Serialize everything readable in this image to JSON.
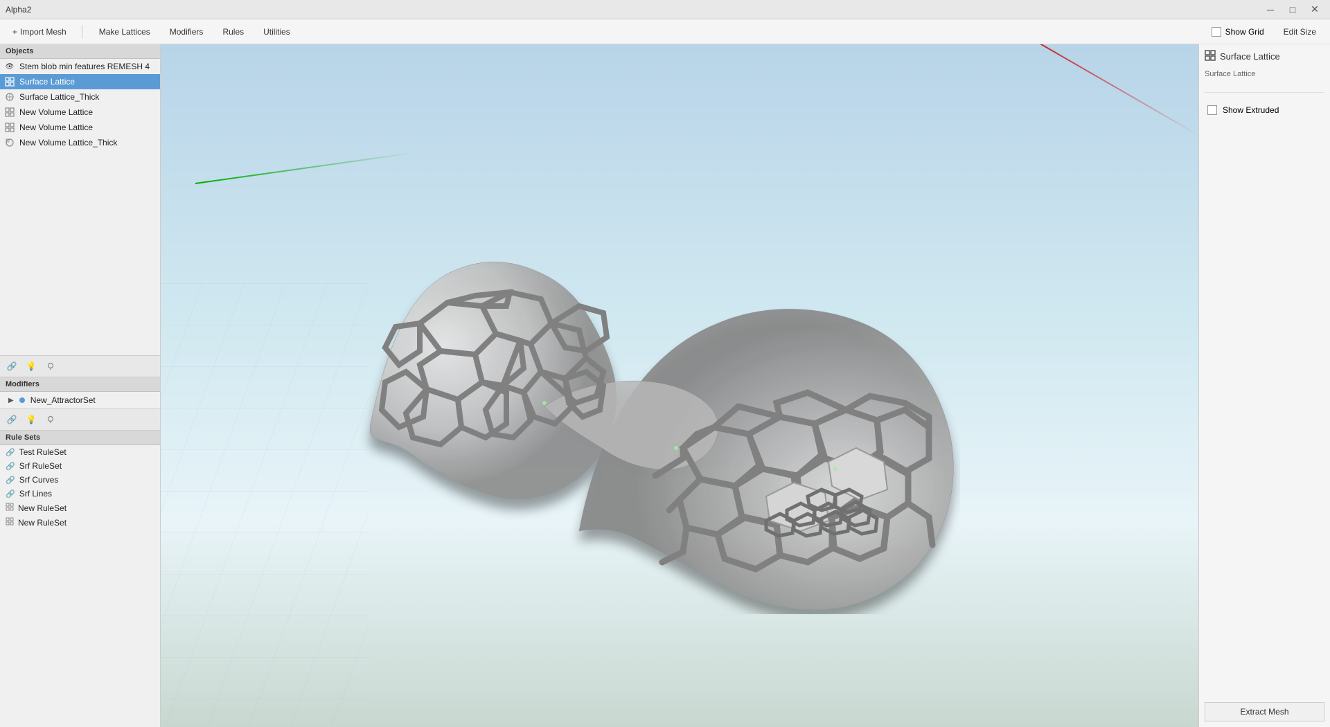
{
  "titlebar": {
    "title": "Alpha2",
    "minimize": "─",
    "maximize": "□",
    "close": "✕"
  },
  "menubar": {
    "import_icon": "+",
    "import_label": "Import Mesh",
    "items": [
      "Make Lattices",
      "Modifiers",
      "Rules",
      "Utilities"
    ],
    "show_grid_label": "Show Grid",
    "edit_size_label": "Edit Size"
  },
  "left_panel": {
    "objects_header": "Objects",
    "objects": [
      {
        "label": "Stem blob min features REMESH 4",
        "icon": "eye",
        "selected": false
      },
      {
        "label": "Surface Lattice",
        "icon": "lattice",
        "selected": true
      },
      {
        "label": "Surface Lattice_Thick",
        "icon": "eye-lattice",
        "selected": false
      },
      {
        "label": "New Volume Lattice",
        "icon": "lattice-grid",
        "selected": false
      },
      {
        "label": "New Volume Lattice",
        "icon": "lattice-grid",
        "selected": false
      },
      {
        "label": "New Volume Lattice_Thick",
        "icon": "eye-lattice-grid",
        "selected": false
      }
    ],
    "toolbar_icons": [
      "link",
      "bulb",
      "bulb-outline"
    ],
    "modifiers_header": "Modifiers",
    "modifiers": [
      {
        "label": "New_AttractorSet",
        "icon": "dot"
      }
    ],
    "modifier_toolbar_icons": [
      "link",
      "bulb",
      "bulb-outline"
    ],
    "rulesets_header": "Rule Sets",
    "rulesets": [
      {
        "label": "Test RuleSet",
        "icon": "link"
      },
      {
        "label": "Srf RuleSet",
        "icon": "link"
      },
      {
        "label": "Srf Curves",
        "icon": "link"
      },
      {
        "label": "Srf Lines",
        "icon": "link"
      },
      {
        "label": "New RuleSet",
        "icon": "grid"
      },
      {
        "label": "New RuleSet",
        "icon": "grid"
      }
    ]
  },
  "right_panel": {
    "title": "Surface Lattice",
    "subtitle": "Surface Lattice",
    "show_extruded_label": "Show Extruded",
    "extract_mesh_label": "Extract Mesh"
  }
}
